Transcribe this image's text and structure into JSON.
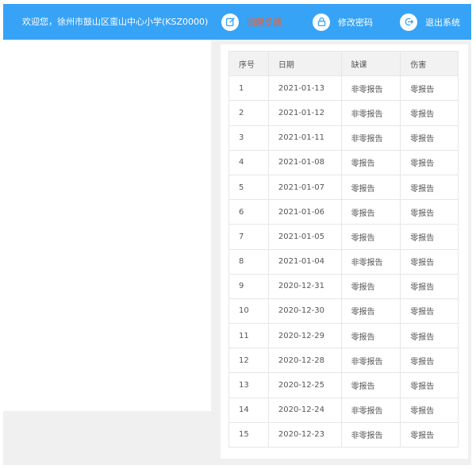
{
  "header": {
    "welcome": "欢迎您，徐州市鼓山区蛮山中心小学(KSZ0000)",
    "nav": [
      {
        "label": "问题反馈",
        "icon": "edit-icon",
        "active": true
      },
      {
        "label": "修改密码",
        "icon": "lock-icon",
        "active": false
      },
      {
        "label": "退出系统",
        "icon": "logout-icon",
        "active": false
      }
    ]
  },
  "table": {
    "headers": [
      "序号",
      "日期",
      "缺课",
      "伤害"
    ],
    "rows": [
      [
        "1",
        "2021-01-13",
        "非零报告",
        "零报告"
      ],
      [
        "2",
        "2021-01-12",
        "非零报告",
        "零报告"
      ],
      [
        "3",
        "2021-01-11",
        "非零报告",
        "零报告"
      ],
      [
        "4",
        "2021-01-08",
        "零报告",
        "零报告"
      ],
      [
        "5",
        "2021-01-07",
        "零报告",
        "零报告"
      ],
      [
        "6",
        "2021-01-06",
        "零报告",
        "零报告"
      ],
      [
        "7",
        "2021-01-05",
        "零报告",
        "零报告"
      ],
      [
        "8",
        "2021-01-04",
        "非零报告",
        "零报告"
      ],
      [
        "9",
        "2020-12-31",
        "零报告",
        "零报告"
      ],
      [
        "10",
        "2020-12-30",
        "零报告",
        "零报告"
      ],
      [
        "11",
        "2020-12-29",
        "零报告",
        "零报告"
      ],
      [
        "12",
        "2020-12-28",
        "非零报告",
        "零报告"
      ],
      [
        "13",
        "2020-12-25",
        "零报告",
        "零报告"
      ],
      [
        "14",
        "2020-12-24",
        "非零报告",
        "零报告"
      ],
      [
        "15",
        "2020-12-23",
        "非零报告",
        "零报告"
      ]
    ]
  },
  "colors": {
    "accent": "#36a3f7",
    "active_nav": "#ff5a1f"
  }
}
